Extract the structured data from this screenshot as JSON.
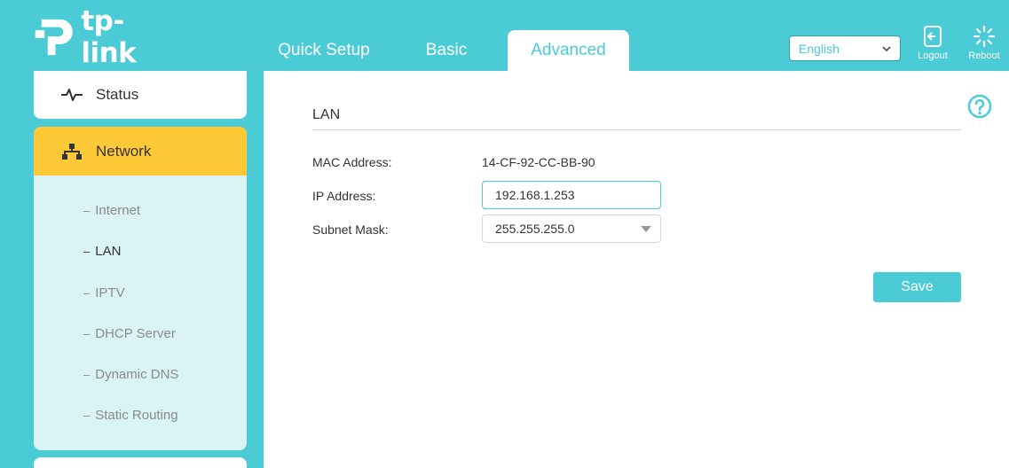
{
  "brand": {
    "name": "tp-link"
  },
  "tabs": [
    {
      "label": "Quick Setup",
      "active": false
    },
    {
      "label": "Basic",
      "active": false
    },
    {
      "label": "Advanced",
      "active": true
    }
  ],
  "header": {
    "language": "English",
    "logout_label": "Logout",
    "reboot_label": "Reboot"
  },
  "sidebar": {
    "items": [
      {
        "label": "Status",
        "icon": "pulse-icon"
      },
      {
        "label": "Network",
        "icon": "network-icon",
        "active": true
      }
    ],
    "submenu": [
      {
        "label": "Internet"
      },
      {
        "label": "LAN",
        "active": true
      },
      {
        "label": "IPTV"
      },
      {
        "label": "DHCP Server"
      },
      {
        "label": "Dynamic DNS"
      },
      {
        "label": "Static Routing"
      }
    ]
  },
  "main": {
    "section_title": "LAN",
    "mac_label": "MAC Address:",
    "mac_value": "14-CF-92-CC-BB-90",
    "ip_label": "IP Address:",
    "ip_value": "192.168.1.253",
    "subnet_label": "Subnet Mask:",
    "subnet_value": "255.255.255.0",
    "save_label": "Save"
  },
  "colors": {
    "accent": "#4acbd6",
    "highlight": "#fec936",
    "submenu_bg": "#daf3f5"
  }
}
